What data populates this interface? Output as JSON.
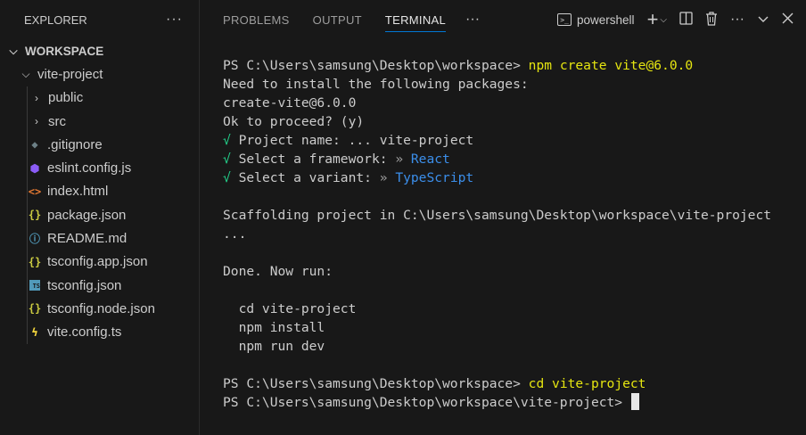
{
  "sidebar": {
    "title": "EXPLORER",
    "more": "···",
    "workspace": "WORKSPACE",
    "project": "vite-project",
    "items": [
      {
        "label": "public",
        "type": "folder"
      },
      {
        "label": "src",
        "type": "folder"
      },
      {
        "label": ".gitignore",
        "icon": "git-icon",
        "color": "#6d8086"
      },
      {
        "label": "eslint.config.js",
        "icon": "eslint-icon",
        "color": "#8b5cf6"
      },
      {
        "label": "index.html",
        "icon": "html-icon",
        "color": "#e37933"
      },
      {
        "label": "package.json",
        "icon": "json-icon",
        "color": "#cbcb41"
      },
      {
        "label": "README.md",
        "icon": "info-icon",
        "color": "#519aba"
      },
      {
        "label": "tsconfig.app.json",
        "icon": "json-icon",
        "color": "#cbcb41"
      },
      {
        "label": "tsconfig.json",
        "icon": "ts-icon",
        "color": "#519aba"
      },
      {
        "label": "tsconfig.node.json",
        "icon": "json-icon",
        "color": "#cbcb41"
      },
      {
        "label": "vite.config.ts",
        "icon": "vite-icon",
        "color": "#f5d63d"
      }
    ]
  },
  "panel": {
    "tabs": [
      "PROBLEMS",
      "OUTPUT",
      "TERMINAL"
    ],
    "active_tab": "TERMINAL",
    "more": "···",
    "shell": "powershell"
  },
  "terminal": {
    "prompt1": "PS C:\\Users\\samsung\\Desktop\\workspace> ",
    "cmd1": "npm create vite@6.0.0",
    "l2": "Need to install the following packages:",
    "l3": "create-vite@6.0.0",
    "l4": "Ok to proceed? (y)",
    "check": "√",
    "q1": " Project name: ",
    "q1_sep": "... ",
    "a1": "vite-project",
    "q2": " Select a framework: ",
    "q2_sep": "» ",
    "a2": "React",
    "q3": " Select a variant: ",
    "q3_sep": "» ",
    "a3": "TypeScript",
    "l8": "Scaffolding project in C:\\Users\\samsung\\Desktop\\workspace\\vite-project",
    "l9": "...",
    "l10": "Done. Now run:",
    "l11": "  cd vite-project",
    "l12": "  npm install",
    "l13": "  npm run dev",
    "prompt2": "PS C:\\Users\\samsung\\Desktop\\workspace> ",
    "cmd2": "cd vite-project",
    "prompt3": "PS C:\\Users\\samsung\\Desktop\\workspace\\vite-project> "
  }
}
